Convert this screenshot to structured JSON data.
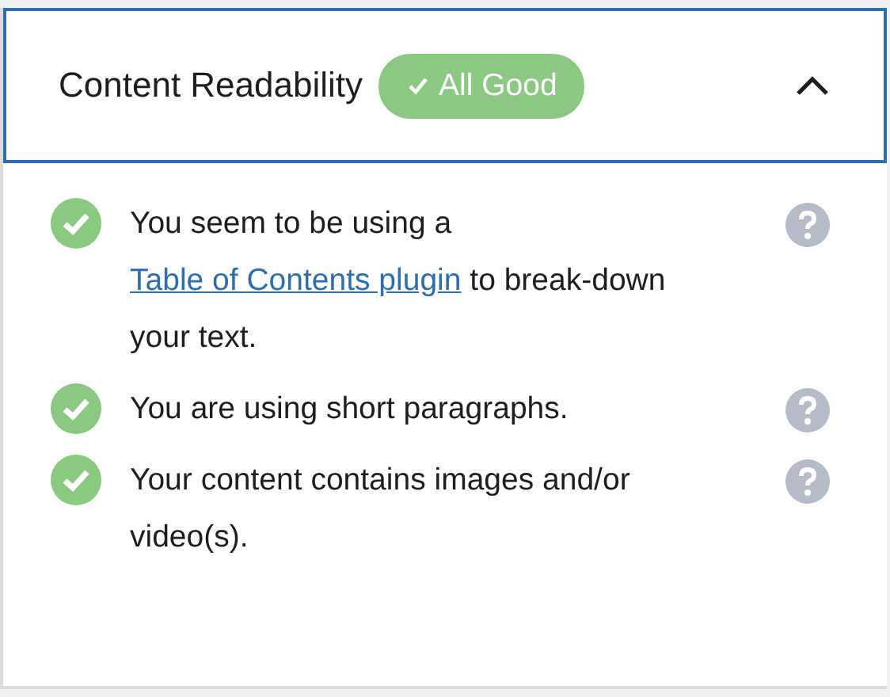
{
  "panel": {
    "title": "Content Readability",
    "badge": {
      "label": "All Good"
    },
    "expanded": true
  },
  "checks": [
    {
      "passed": true,
      "parts": [
        {
          "kind": "text",
          "text": "You seem to be using a "
        },
        {
          "kind": "link",
          "text": "Table of Contents plugin"
        },
        {
          "kind": "text",
          "text": " to break-down your text."
        }
      ]
    },
    {
      "passed": true,
      "parts": [
        {
          "kind": "text",
          "text": "You are using short paragraphs."
        }
      ]
    },
    {
      "passed": true,
      "parts": [
        {
          "kind": "text",
          "text": "Your content contains images and/or video(s)."
        }
      ]
    }
  ]
}
